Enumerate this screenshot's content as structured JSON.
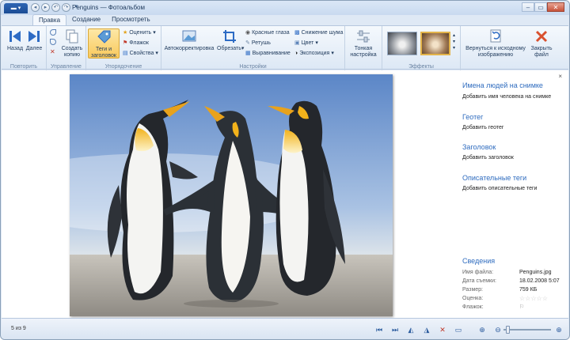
{
  "window": {
    "title": "Penguins — Фотоальбом"
  },
  "tabs": [
    {
      "label": "Правка"
    },
    {
      "label": "Создание"
    },
    {
      "label": "Просмотреть"
    }
  ],
  "ribbon": {
    "back": "Назад",
    "forward": "Далее",
    "repeat_group": "Повторить",
    "copy": "Создать копию",
    "manage_group": "Управление",
    "tags": "Теги и заголовок",
    "rate": "Оценить",
    "flag": "Флажок",
    "props": "Свойства",
    "organize_group": "Упорядочение",
    "autofix": "Автокорректировка",
    "crop": "Обрезать",
    "redeye": "Красные глаза",
    "retouch": "Ретушь",
    "straighten": "Выравнивание",
    "noise": "Снижение шума",
    "color": "Цвет",
    "exposure": "Экспозиция",
    "fine": "Тонкая настройка",
    "adjust_group": "Настройки",
    "effects_group": "Эффекты",
    "revert": "Вернуться к исходному изображению",
    "close_file": "Закрыть файл"
  },
  "pane": {
    "people_title": "Имена людей на снимке",
    "people_add": "Добавить имя человека на снимке",
    "geo_title": "Геотег",
    "geo_add": "Добавить геотег",
    "caption_title": "Заголовок",
    "caption_add": "Добавить заголовок",
    "tags_title": "Описательные теги",
    "tags_add": "Добавить описательные теги",
    "info_title": "Сведения",
    "info": [
      {
        "k": "Имя файла:",
        "v": "Penguins.jpg"
      },
      {
        "k": "Дата съемки:",
        "v": "18.02.2008  5:07"
      },
      {
        "k": "Размер:",
        "v": "759 КБ"
      },
      {
        "k": "Оценка:",
        "v": "☆☆☆☆☆"
      },
      {
        "k": "Флажок:",
        "v": "⚐"
      }
    ]
  },
  "status": {
    "count": "5 из 9"
  },
  "zoom": {
    "level": 0.05
  }
}
